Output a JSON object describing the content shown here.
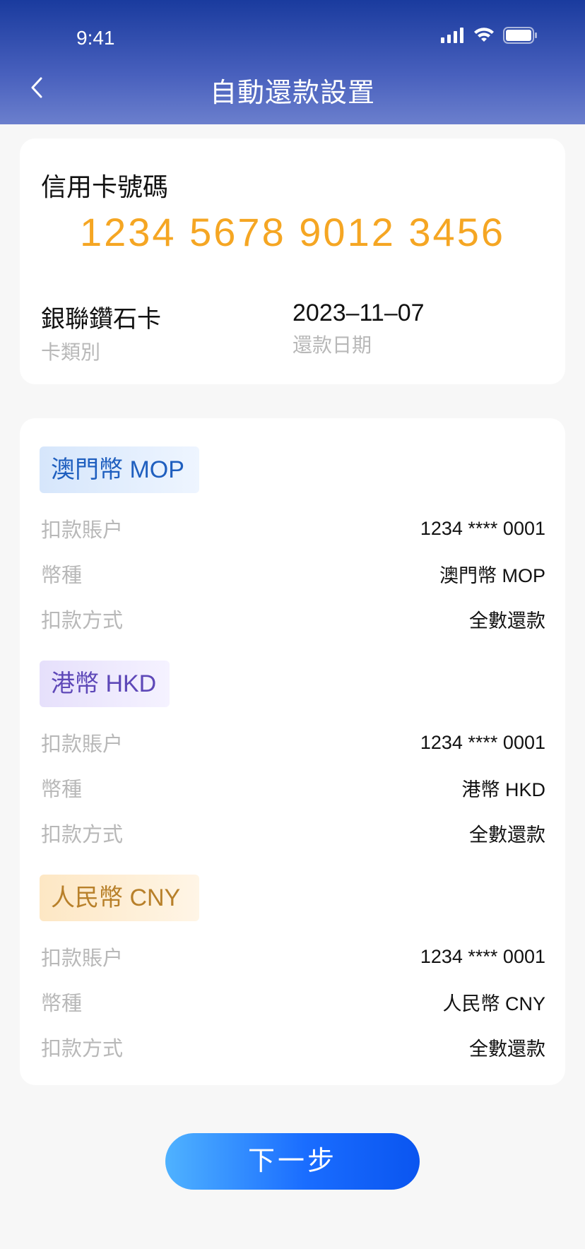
{
  "status_bar": {
    "time": "9:41"
  },
  "header": {
    "title": "自動還款設置"
  },
  "card_info": {
    "number_label": "信用卡號碼",
    "number": "1234 5678 9012 3456",
    "card_type": "銀聯鑽石卡",
    "card_type_label": "卡類別",
    "repay_date": "2023–11–07",
    "repay_date_label": "還款日期"
  },
  "currencies": [
    {
      "tag": "澳門幣 MOP",
      "account_label": "扣款賬户",
      "account": "1234 **** 0001",
      "currency_label": "幣種",
      "currency": "澳門幣 MOP",
      "method_label": "扣款方式",
      "method": "全數還款"
    },
    {
      "tag": "港幣 HKD",
      "account_label": "扣款賬户",
      "account": "1234 **** 0001",
      "currency_label": "幣種",
      "currency": "港幣 HKD",
      "method_label": "扣款方式",
      "method": "全數還款"
    },
    {
      "tag": "人民幣 CNY",
      "account_label": "扣款賬户",
      "account": "1234 **** 0001",
      "currency_label": "幣種",
      "currency": "人民幣 CNY",
      "method_label": "扣款方式",
      "method": "全數還款"
    }
  ],
  "next_button": {
    "label": "下一步"
  },
  "colors": {
    "header_gradient_top": "#1a3b9e",
    "card_number": "#f5a623",
    "mop_tag_text": "#1f5fbf",
    "hkd_tag_text": "#5e48b8",
    "cny_tag_text": "#b8802a",
    "button_gradient_end": "#0a55f0"
  }
}
